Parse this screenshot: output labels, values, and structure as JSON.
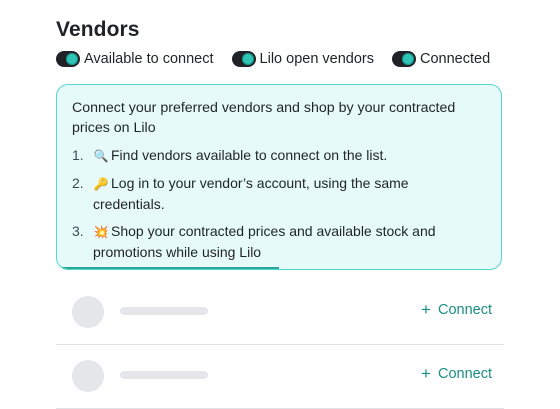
{
  "page": {
    "title": "Vendors"
  },
  "filters": [
    {
      "label": "Available to connect",
      "on": true,
      "icon": "toggle-switch"
    },
    {
      "label": "Lilo open vendors",
      "on": true,
      "icon": "toggle-switch"
    },
    {
      "label": "Connected",
      "on": true,
      "icon": "toggle-switch"
    }
  ],
  "info": {
    "heading": "Connect your preferred vendors and shop by your contracted prices on Lilo",
    "steps": [
      {
        "number": "1.",
        "emoji": "🔍",
        "icon": "magnifying-glass-icon",
        "text": "Find vendors available to connect on the list."
      },
      {
        "number": "2.",
        "emoji": "🔑",
        "icon": "key-icon",
        "text": "Log in to your vendor’s account, using the same credentials."
      },
      {
        "number": "3.",
        "emoji": "💥",
        "icon": "collision-icon",
        "text": "Shop your contracted prices and available stock and promotions while using Lilo"
      }
    ],
    "progress_fraction": 0.5
  },
  "vendors": [
    {
      "connect_label": "Connect",
      "loading": true
    },
    {
      "connect_label": "Connect",
      "loading": true
    }
  ],
  "colors": {
    "accent": "#1b8f84",
    "info_bg": "#e6fbf9",
    "info_border": "#54d6cc",
    "skeleton": "#e4e6ea"
  }
}
